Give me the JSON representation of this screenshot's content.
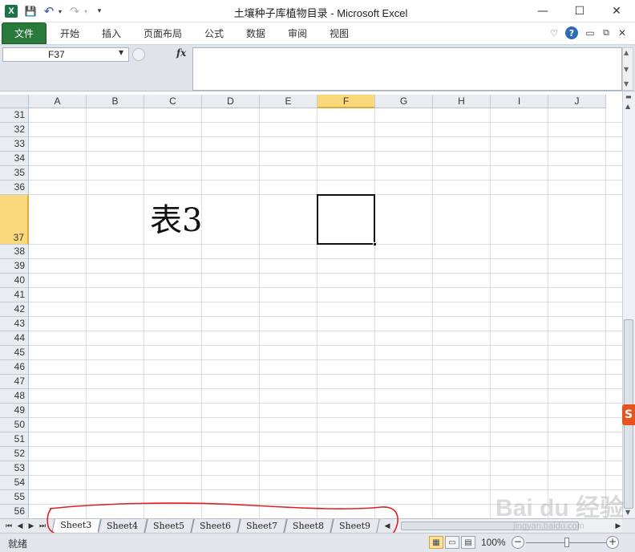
{
  "titlebar": {
    "title": "土壤种子库植物目录  -  Microsoft Excel",
    "app_icon": "X",
    "qa_save": "💾",
    "qa_undo": "↶",
    "qa_redo": "↷",
    "qa_customize": "▾",
    "minimize": "—",
    "maximize": "☐",
    "close": "✕"
  },
  "ribbon": {
    "tabs": [
      "文件",
      "开始",
      "插入",
      "页面布局",
      "公式",
      "数据",
      "审阅",
      "视图"
    ],
    "help": "?"
  },
  "formula_bar": {
    "name_box": "F37",
    "fx": "fx",
    "formula": ""
  },
  "grid": {
    "columns": [
      "A",
      "B",
      "C",
      "D",
      "E",
      "F",
      "G",
      "H",
      "I",
      "J"
    ],
    "selected_column": "F",
    "rows": [
      "31",
      "32",
      "33",
      "34",
      "35",
      "36",
      "37",
      "38",
      "39",
      "40",
      "41",
      "42",
      "43",
      "44",
      "45",
      "46",
      "47",
      "48",
      "49",
      "50",
      "51",
      "52",
      "53",
      "54",
      "55",
      "56"
    ],
    "selected_row": "37",
    "cell_text": "表3"
  },
  "sheet_tabs": [
    "Sheet3",
    "Sheet4",
    "Sheet5",
    "Sheet6",
    "Sheet7",
    "Sheet8",
    "Sheet9"
  ],
  "active_sheet": "Sheet3",
  "status": {
    "ready": "就绪",
    "zoom": "100%"
  },
  "watermark": {
    "brand": "Bai du 经验",
    "url": "jingyan.baidu.com"
  },
  "colors": {
    "file_tab": "#2a7a3b",
    "selected_header": "#f9d97c",
    "annotation": "#e02020"
  }
}
